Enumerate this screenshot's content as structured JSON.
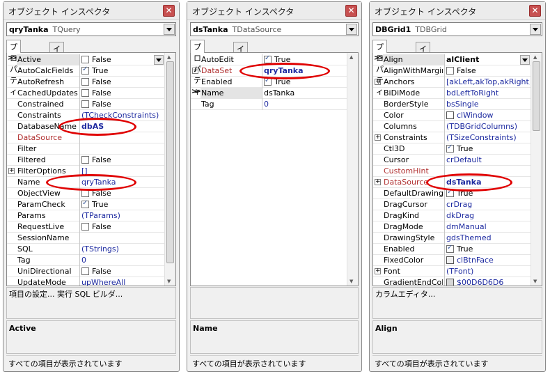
{
  "panels": [
    {
      "title": "オブジェクト インスペクタ",
      "component_name": "qryTanka",
      "component_type": "TQuery",
      "tab_properties": "プロパティ",
      "tab_events": "イベント",
      "editor_links": "項目の設定... 実行 SQL ビルダ...",
      "description": "Active",
      "status": "すべての項目が表示されています",
      "rows": [
        {
          "name": "Active",
          "value": "False",
          "checkbox": false,
          "dropdown": true,
          "selected": true
        },
        {
          "name": "AutoCalcFields",
          "value": "True",
          "checkbox": true
        },
        {
          "name": "AutoRefresh",
          "value": "False",
          "checkbox": false
        },
        {
          "name": "CachedUpdates",
          "value": "False",
          "checkbox": false
        },
        {
          "name": "Constrained",
          "value": "False",
          "checkbox": false
        },
        {
          "name": "Constraints",
          "value": "(TCheckConstraints)",
          "style": "blue"
        },
        {
          "name": "DatabaseName",
          "value": "dbAS",
          "style": "bold-blue"
        },
        {
          "name": "DataSource",
          "value": "",
          "name_style": "red"
        },
        {
          "name": "Filter",
          "value": ""
        },
        {
          "name": "Filtered",
          "value": "False",
          "checkbox": false
        },
        {
          "name": "FilterOptions",
          "value": "[]",
          "style": "blue",
          "expand": true
        },
        {
          "name": "Name",
          "value": "qryTanka",
          "style": "blue"
        },
        {
          "name": "ObjectView",
          "value": "False",
          "checkbox": false
        },
        {
          "name": "ParamCheck",
          "value": "True",
          "checkbox": true
        },
        {
          "name": "Params",
          "value": "(TParams)",
          "style": "blue"
        },
        {
          "name": "RequestLive",
          "value": "False",
          "checkbox": false
        },
        {
          "name": "SessionName",
          "value": ""
        },
        {
          "name": "SQL",
          "value": "(TStrings)",
          "style": "blue"
        },
        {
          "name": "Tag",
          "value": "0",
          "style": "blue"
        },
        {
          "name": "UniDirectional",
          "value": "False",
          "checkbox": false
        },
        {
          "name": "UpdateMode",
          "value": "upWhereAll",
          "style": "blue"
        }
      ]
    },
    {
      "title": "オブジェクト インスペクタ",
      "component_name": "dsTanka",
      "component_type": "TDataSource",
      "tab_properties": "プロパティ",
      "tab_events": "イベント",
      "editor_links": "",
      "description": "Name",
      "status": "すべての項目が表示されています",
      "rows": [
        {
          "name": "AutoEdit",
          "value": "True",
          "checkbox": true
        },
        {
          "name": "DataSet",
          "value": "qryTanka",
          "style": "bold-blue",
          "name_style": "red",
          "expand": true
        },
        {
          "name": "Enabled",
          "value": "True",
          "checkbox": true
        },
        {
          "name": "Name",
          "value": "dsTanka",
          "selected": true
        },
        {
          "name": "Tag",
          "value": "0",
          "style": "blue"
        }
      ]
    },
    {
      "title": "オブジェクト インスペクタ",
      "component_name": "DBGrid1",
      "component_type": "TDBGrid",
      "tab_properties": "プロパティ",
      "tab_events": "イベント",
      "editor_links": "カラムエディタ...",
      "description": "Align",
      "status": "すべての項目が表示されています",
      "rows": [
        {
          "name": "Align",
          "value": "alClient",
          "style": "bold",
          "dropdown": true,
          "selected": true
        },
        {
          "name": "AlignWithMargins",
          "value": "False",
          "checkbox": false
        },
        {
          "name": "Anchors",
          "value": "[akLeft,akTop,akRight,akBottom]",
          "style": "blue",
          "expand": true
        },
        {
          "name": "BiDiMode",
          "value": "bdLeftToRight",
          "style": "blue"
        },
        {
          "name": "BorderStyle",
          "value": "bsSingle",
          "style": "blue"
        },
        {
          "name": "Color",
          "value": "clWindow",
          "style": "blue",
          "swatch": "#ffffff"
        },
        {
          "name": "Columns",
          "value": "(TDBGridColumns)",
          "style": "blue"
        },
        {
          "name": "Constraints",
          "value": "(TSizeConstraints)",
          "style": "blue",
          "expand": true
        },
        {
          "name": "Ctl3D",
          "value": "True",
          "checkbox": true
        },
        {
          "name": "Cursor",
          "value": "crDefault",
          "style": "blue"
        },
        {
          "name": "CustomHint",
          "value": "",
          "name_style": "red"
        },
        {
          "name": "DataSource",
          "value": "dsTanka",
          "style": "bold-blue",
          "name_style": "red",
          "expand": true
        },
        {
          "name": "DefaultDrawing",
          "value": "True",
          "checkbox": true
        },
        {
          "name": "DragCursor",
          "value": "crDrag",
          "style": "blue"
        },
        {
          "name": "DragKind",
          "value": "dkDrag",
          "style": "blue"
        },
        {
          "name": "DragMode",
          "value": "dmManual",
          "style": "blue"
        },
        {
          "name": "DrawingStyle",
          "value": "gdsThemed",
          "style": "blue"
        },
        {
          "name": "Enabled",
          "value": "True",
          "checkbox": true
        },
        {
          "name": "FixedColor",
          "value": "clBtnFace",
          "style": "blue",
          "swatch": "#f0f0f0"
        },
        {
          "name": "Font",
          "value": "(TFont)",
          "style": "blue",
          "expand": true
        },
        {
          "name": "GradientEndColor",
          "value": "$00D6D6D6",
          "style": "blue",
          "swatch": "#d6d6d6"
        }
      ]
    }
  ]
}
